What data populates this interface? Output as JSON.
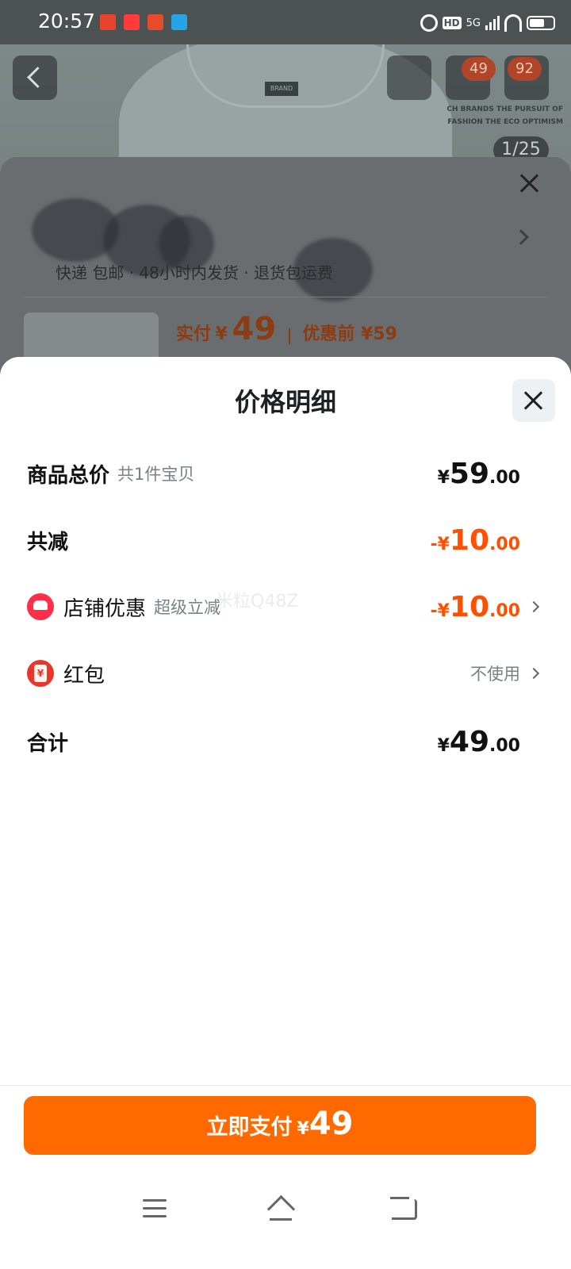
{
  "status_bar": {
    "time": "20:57",
    "network_badge": "HD",
    "network_type": "5G"
  },
  "background_page": {
    "cart_count_a": "49",
    "cart_count_b": "92",
    "banner_text": "CH BRANDS THE PURSUIT OF FASHION THE ECO OPTIMISM",
    "image_index": "1/25",
    "tag_text": "BRAND"
  },
  "prev_sheet": {
    "shipping_text": "快递 包邮 · 48小时内发货 · 退货包运费",
    "paid_label": "实付",
    "paid_yen": "¥",
    "paid_amount": "49",
    "before_label": "优惠前 ¥59"
  },
  "sheet": {
    "title": "价格明细",
    "rows": {
      "total": {
        "label": "商品总价",
        "sub": "共1件宝贝",
        "yen": "¥",
        "int": "59",
        "dec": ".00"
      },
      "reduce": {
        "label": "共减",
        "yen": "-¥",
        "int": "10",
        "dec": ".00"
      },
      "shop": {
        "label": "店铺优惠",
        "sub": "超级立减",
        "yen": "-¥",
        "int": "10",
        "dec": ".00"
      },
      "hongbao": {
        "label": "红包",
        "value": "不使用"
      },
      "sum": {
        "label": "合计",
        "yen": "¥",
        "int": "49",
        "dec": ".00"
      }
    },
    "watermark": "米粒Q48Z"
  },
  "pay_button": {
    "label": "立即支付",
    "yen": "¥",
    "amount": "49"
  },
  "colors": {
    "accent_orange": "#ff6a00",
    "discount_orange": "#ff5000",
    "shop_icon": "#ff2f4a",
    "hongbao_icon": "#e8372a"
  },
  "icons": {
    "close": "close-icon",
    "chevron": "chevron-right-icon",
    "shop": "shop-icon",
    "hongbao": "red-packet-icon"
  }
}
